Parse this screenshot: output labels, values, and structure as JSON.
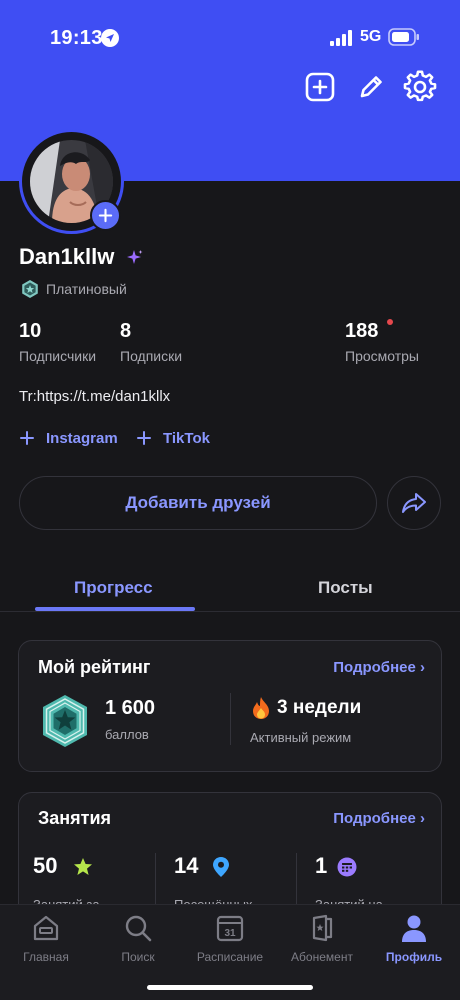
{
  "status_bar": {
    "time": "19:13",
    "network": "5G"
  },
  "header": {
    "icons": [
      "add-square-icon",
      "pencil-icon",
      "gear-icon"
    ]
  },
  "profile": {
    "username": "Dan1kllw",
    "tier": "Платиновый",
    "stats": [
      {
        "value": "10",
        "label": "Подписчики"
      },
      {
        "value": "8",
        "label": "Подписки"
      },
      {
        "value": "188",
        "label": "Просмотры"
      }
    ],
    "bio": "Tr:https://t.me/dan1kllx",
    "links": [
      "Instagram",
      "TikTok"
    ],
    "add_friends_label": "Добавить друзей"
  },
  "tabs": [
    {
      "label": "Прогресс",
      "active": true
    },
    {
      "label": "Посты",
      "active": false
    }
  ],
  "rating_card": {
    "title": "Мой рейтинг",
    "more": "Подробнее",
    "points": "1 600",
    "points_label": "баллов",
    "streak": "3 недели",
    "streak_label": "Активный режим"
  },
  "activity_card": {
    "title": "Занятия",
    "more": "Подробнее",
    "items": [
      {
        "value": "50",
        "label": "Занятий за"
      },
      {
        "value": "14",
        "label": "Посещённых"
      },
      {
        "value": "1",
        "label": "Занятий на"
      }
    ]
  },
  "tabbar": [
    {
      "label": "Главная",
      "icon": "home-icon",
      "active": false
    },
    {
      "label": "Поиск",
      "icon": "search-icon",
      "active": false
    },
    {
      "label": "Расписание",
      "icon": "calendar-icon",
      "active": false,
      "calendar_day": "31"
    },
    {
      "label": "Абонемент",
      "icon": "membership-card-icon",
      "active": false
    },
    {
      "label": "Профиль",
      "icon": "profile-icon",
      "active": true
    }
  ],
  "colors": {
    "brand": "#3f4ef3",
    "accent": "#8a97ff",
    "background": "#17171a"
  }
}
